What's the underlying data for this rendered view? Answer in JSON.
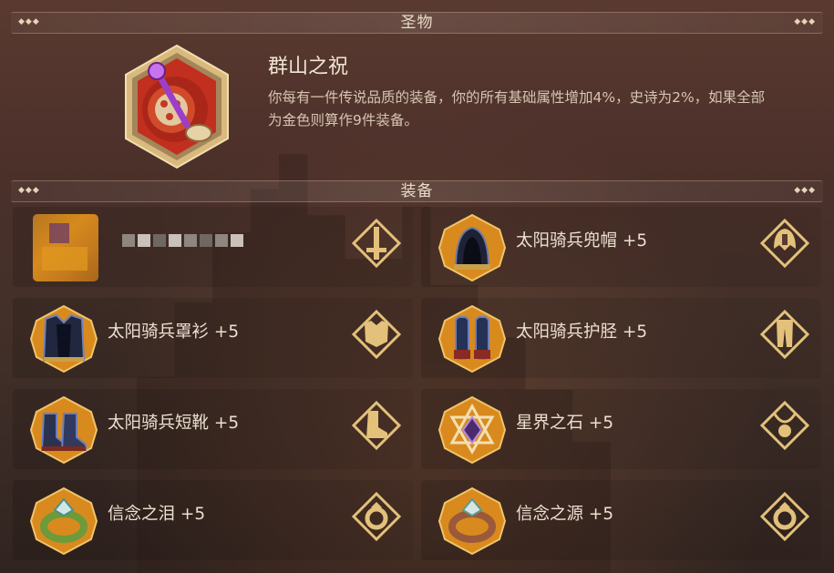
{
  "relic_section": {
    "title": "圣物",
    "dots": "◆◆◆"
  },
  "relic": {
    "name": "群山之祝",
    "description": "你每有一件传说品质的装备，你的所有基础属性增加4%，史诗为2%，如果全部为金色则算作9件装备。",
    "icon": "relic-scepter-icon"
  },
  "equipment_section": {
    "title": "装备",
    "dots": "◆◆◆"
  },
  "colors": {
    "gold": "#e3c17a",
    "orange_frame": "#c77a18",
    "relic_red": "#b33320"
  },
  "equipment": [
    {
      "slot": "weapon",
      "name": "",
      "icon": "obscured-weapon-icon",
      "type_icon": "weapon-slot-icon"
    },
    {
      "slot": "helmet",
      "name": "太阳骑兵兜帽 +5",
      "icon": "hood-icon",
      "type_icon": "helmet-slot-icon"
    },
    {
      "slot": "chest",
      "name": "太阳骑兵罩衫 +5",
      "icon": "tabard-icon",
      "type_icon": "chest-slot-icon"
    },
    {
      "slot": "legs",
      "name": "太阳骑兵护胫 +5",
      "icon": "greaves-icon",
      "type_icon": "legs-slot-icon"
    },
    {
      "slot": "boots",
      "name": "太阳骑兵短靴 +5",
      "icon": "boots-icon",
      "type_icon": "boots-slot-icon"
    },
    {
      "slot": "amulet",
      "name": "星界之石 +5",
      "icon": "star-stone-icon",
      "type_icon": "amulet-slot-icon"
    },
    {
      "slot": "ring1",
      "name": "信念之泪 +5",
      "icon": "ring-green-icon",
      "type_icon": "ring-slot-icon"
    },
    {
      "slot": "ring2",
      "name": "信念之源 +5",
      "icon": "ring-bronze-icon",
      "type_icon": "ring-slot-icon"
    }
  ]
}
